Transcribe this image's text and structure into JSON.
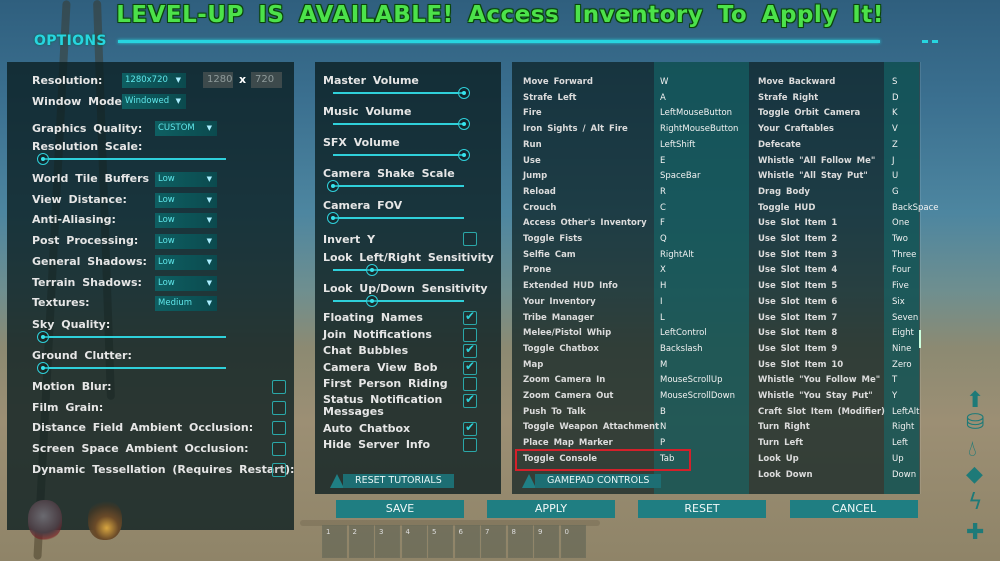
{
  "banner": "LEVEL-UP IS AVAILABLE! Access Inventory To Apply It!",
  "section_title": "OPTIONS",
  "video": {
    "resolution": {
      "label": "Resolution:",
      "value": "1280x720",
      "width": "1280",
      "height": "720",
      "separator": "x"
    },
    "window_mode": {
      "label": "Window Mode:",
      "value": "Windowed"
    },
    "graphics_quality": {
      "label": "Graphics Quality:",
      "value": "CUSTOM"
    },
    "resolution_scale": {
      "label": "Resolution Scale:",
      "value": 0.0
    },
    "dropdowns": [
      {
        "label": "World Tile Buffers",
        "value": "Low"
      },
      {
        "label": "View Distance:",
        "value": "Low"
      },
      {
        "label": "Anti-Aliasing:",
        "value": "Low"
      },
      {
        "label": "Post Processing:",
        "value": "Low"
      },
      {
        "label": "General Shadows:",
        "value": "Low"
      },
      {
        "label": "Terrain Shadows:",
        "value": "Low"
      },
      {
        "label": "Textures:",
        "value": "Medium"
      }
    ],
    "sky_quality": {
      "label": "Sky Quality:",
      "value": 0.0
    },
    "ground_clutter": {
      "label": "Ground Clutter:",
      "value": 0.0
    },
    "checkboxes": [
      {
        "label": "Motion Blur:",
        "checked": false
      },
      {
        "label": "Film Grain:",
        "checked": false
      },
      {
        "label": "Distance Field Ambient Occlusion:",
        "checked": false
      },
      {
        "label": "Screen Space Ambient Occlusion:",
        "checked": false
      },
      {
        "label": "Dynamic Tessellation (Requires Restart):",
        "checked": false
      }
    ]
  },
  "audio": {
    "sliders": [
      {
        "label": "Master Volume",
        "value": 1.0
      },
      {
        "label": "Music Volume",
        "value": 1.0
      },
      {
        "label": "SFX Volume",
        "value": 1.0
      },
      {
        "label": "Camera Shake Scale",
        "value": 0.0
      },
      {
        "label": "Camera FOV",
        "value": 0.0
      }
    ],
    "invert_y": {
      "label": "Invert Y",
      "checked": false
    },
    "look_lr": {
      "label": "Look Left/Right Sensitivity",
      "value": 0.3
    },
    "look_ud": {
      "label": "Look Up/Down Sensitivity",
      "value": 0.3
    },
    "checkboxes": [
      {
        "label": "Floating Names",
        "checked": true
      },
      {
        "label": "Join Notifications",
        "checked": false
      },
      {
        "label": "Chat Bubbles",
        "checked": true
      },
      {
        "label": "Camera View Bob",
        "checked": true
      },
      {
        "label": "First Person Riding",
        "checked": false
      },
      {
        "label": "Status Notification Messages",
        "checked": true
      },
      {
        "label": "Auto Chatbox",
        "checked": true
      },
      {
        "label": "Hide Server Info",
        "checked": false
      }
    ],
    "reset_tutorials": "RESET TUTORIALS"
  },
  "keybinds": {
    "left": [
      {
        "action": "Move Forward",
        "key": "W"
      },
      {
        "action": "Strafe Left",
        "key": "A"
      },
      {
        "action": "Fire",
        "key": "LeftMouseButton"
      },
      {
        "action": "Iron Sights / Alt Fire",
        "key": "RightMouseButton"
      },
      {
        "action": "Run",
        "key": "LeftShift"
      },
      {
        "action": "Use",
        "key": "E"
      },
      {
        "action": "Jump",
        "key": "SpaceBar"
      },
      {
        "action": "Reload",
        "key": "R"
      },
      {
        "action": "Crouch",
        "key": "C"
      },
      {
        "action": "Access Other's Inventory",
        "key": "F"
      },
      {
        "action": "Toggle Fists",
        "key": "Q"
      },
      {
        "action": "Selfie Cam",
        "key": "RightAlt"
      },
      {
        "action": "Prone",
        "key": "X"
      },
      {
        "action": "Extended HUD Info",
        "key": "H"
      },
      {
        "action": "Your Inventory",
        "key": "I"
      },
      {
        "action": "Tribe Manager",
        "key": "L"
      },
      {
        "action": "Melee/Pistol Whip",
        "key": "LeftControl"
      },
      {
        "action": "Toggle Chatbox",
        "key": "Backslash"
      },
      {
        "action": "Map",
        "key": "M"
      },
      {
        "action": "Zoom Camera In",
        "key": "MouseScrollUp"
      },
      {
        "action": "Zoom Camera Out",
        "key": "MouseScrollDown"
      },
      {
        "action": "Push To Talk",
        "key": "B"
      },
      {
        "action": "Toggle Weapon Attachment",
        "key": "N"
      },
      {
        "action": "Place Map Marker",
        "key": "P"
      },
      {
        "action": "Toggle Console",
        "key": "Tab",
        "highlighted": true
      }
    ],
    "right": [
      {
        "action": "Move Backward",
        "key": "S"
      },
      {
        "action": "Strafe Right",
        "key": "D"
      },
      {
        "action": "Toggle Orbit Camera",
        "key": "K"
      },
      {
        "action": "Your Craftables",
        "key": "V"
      },
      {
        "action": "Defecate",
        "key": "Z"
      },
      {
        "action": "Whistle \"All Follow Me\"",
        "key": "J"
      },
      {
        "action": "Whistle \"All Stay Put\"",
        "key": "U"
      },
      {
        "action": "Drag Body",
        "key": "G"
      },
      {
        "action": "Toggle HUD",
        "key": "BackSpace"
      },
      {
        "action": "Use Slot Item 1",
        "key": "One"
      },
      {
        "action": "Use Slot Item 2",
        "key": "Two"
      },
      {
        "action": "Use Slot Item 3",
        "key": "Three"
      },
      {
        "action": "Use Slot Item 4",
        "key": "Four"
      },
      {
        "action": "Use Slot Item 5",
        "key": "Five"
      },
      {
        "action": "Use Slot Item 6",
        "key": "Six"
      },
      {
        "action": "Use Slot Item 7",
        "key": "Seven"
      },
      {
        "action": "Use Slot Item 8",
        "key": "Eight"
      },
      {
        "action": "Use Slot Item 9",
        "key": "Nine"
      },
      {
        "action": "Use Slot Item 10",
        "key": "Zero"
      },
      {
        "action": "Whistle \"You Follow Me\"",
        "key": "T"
      },
      {
        "action": "Whistle \"You Stay Put\"",
        "key": "Y"
      },
      {
        "action": "Craft Slot Item (Modifier)",
        "key": "LeftAlt"
      },
      {
        "action": "Turn Right",
        "key": "Right"
      },
      {
        "action": "Turn Left",
        "key": "Left"
      },
      {
        "action": "Look Up",
        "key": "Up"
      },
      {
        "action": "Look Down",
        "key": "Down"
      }
    ],
    "gamepad_controls": "GAMEPAD CONTROLS"
  },
  "buttons": {
    "save": "SAVE",
    "apply": "APPLY",
    "reset": "RESET",
    "cancel": "CANCEL"
  },
  "hotbar": [
    "1",
    "2",
    "3",
    "4",
    "5",
    "6",
    "7",
    "8",
    "9",
    "0"
  ],
  "colors": {
    "accent": "#27d5e0",
    "banner": "#4ce24a",
    "button": "#1f7e82",
    "highlight": "#d4202a"
  }
}
